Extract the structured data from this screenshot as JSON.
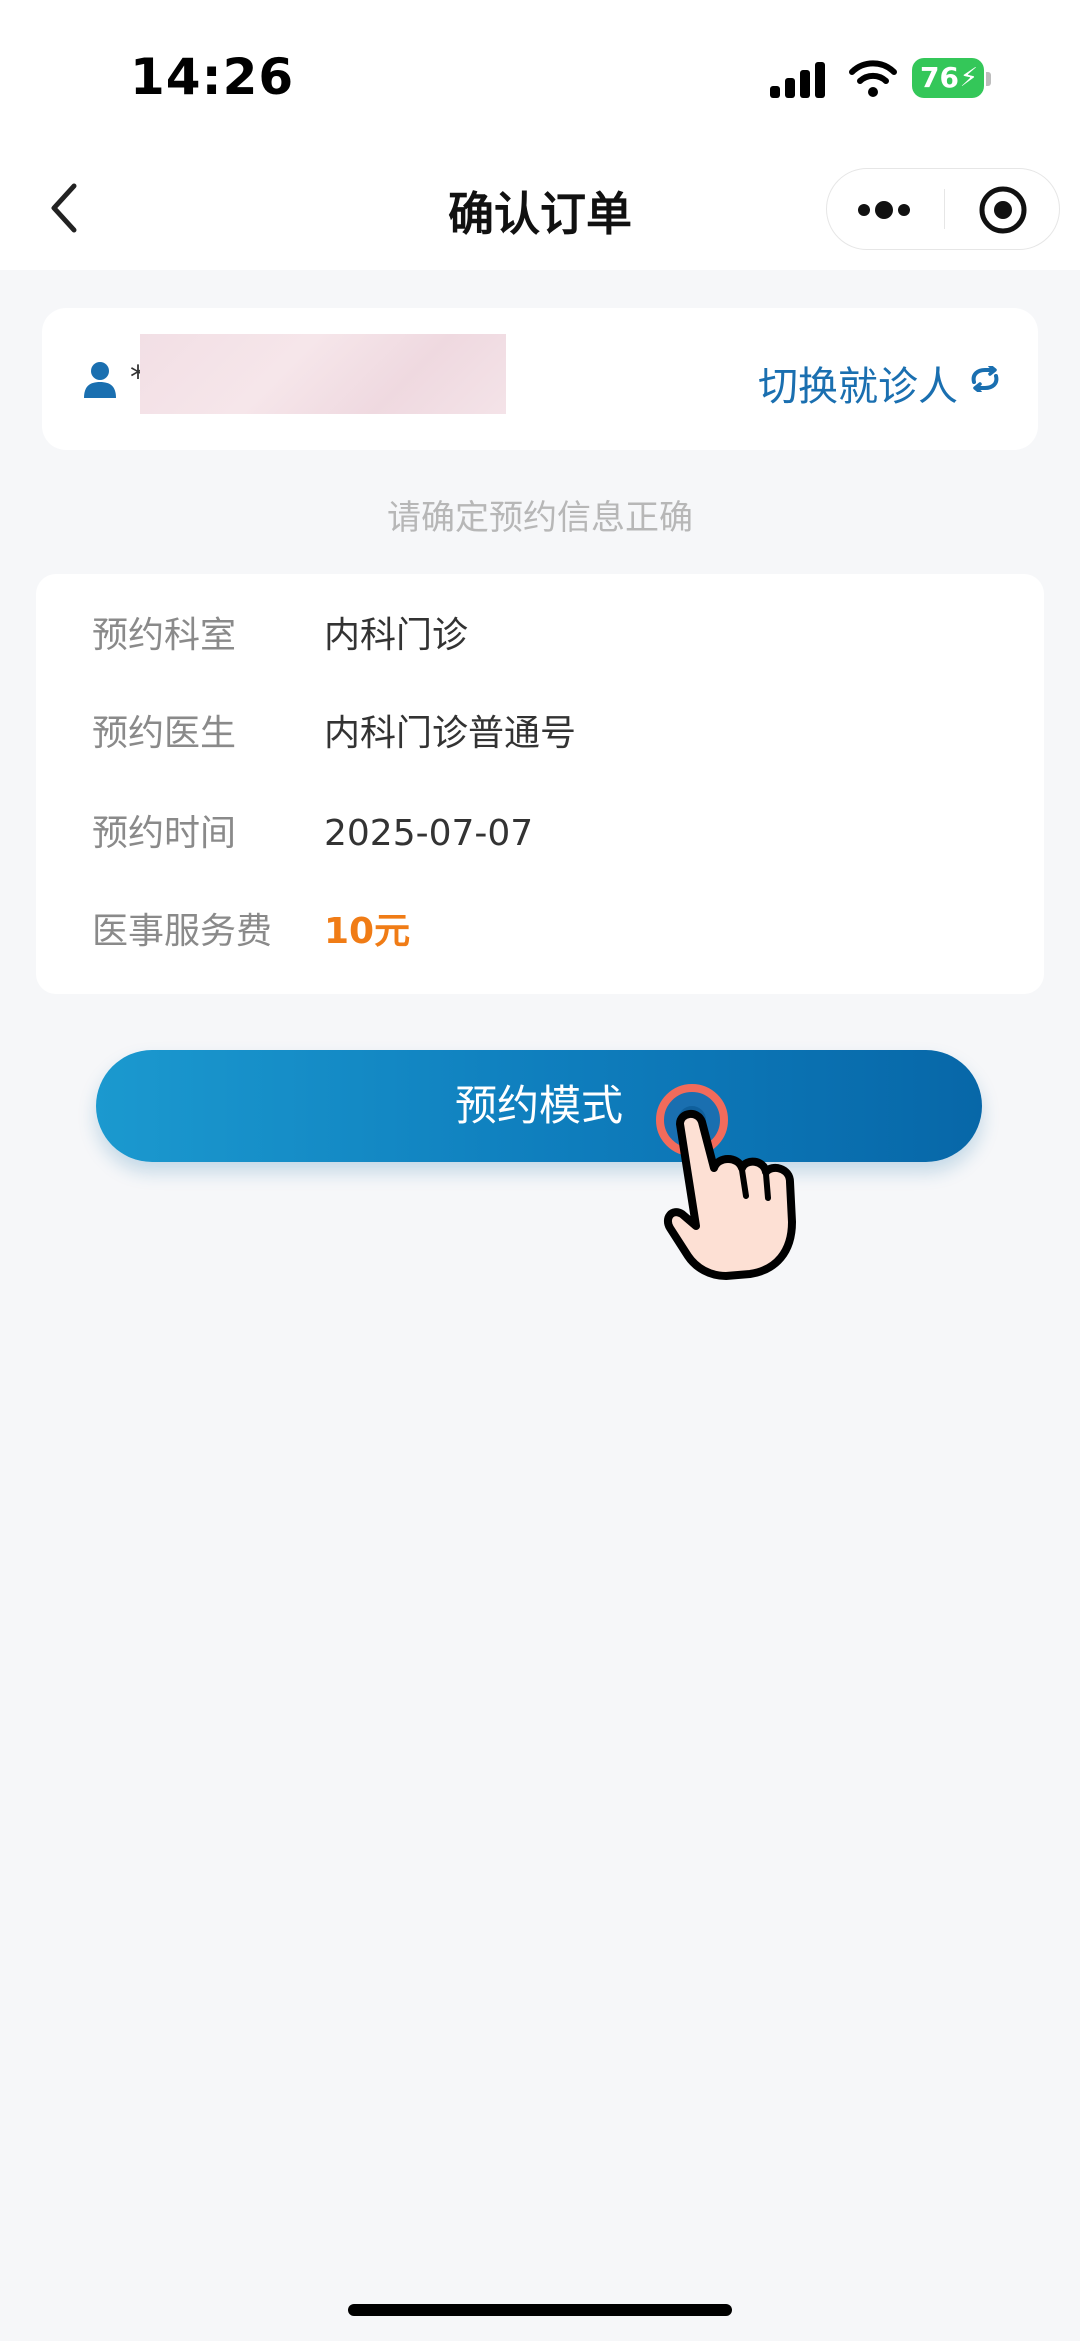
{
  "status_bar": {
    "time": "14:26",
    "battery_level": "76",
    "signal_bars": 4,
    "icons": [
      "cellular-signal-icon",
      "wifi-icon",
      "battery-charging-icon"
    ]
  },
  "nav": {
    "title": "确认订单",
    "back_icon": "chevron-left-icon",
    "more_icon": "more-dots-icon",
    "close_icon": "target-icon"
  },
  "patient": {
    "name_prefix": "*",
    "switch_label": "切换就诊人",
    "icons": [
      "person-icon",
      "switch-refresh-icon"
    ]
  },
  "hint": "请确定预约信息正确",
  "appointment": [
    {
      "label": "预约科室",
      "value": "内科门诊"
    },
    {
      "label": "预约医生",
      "value": "内科门诊普通号"
    },
    {
      "label": "预约时间",
      "value": "2025-07-07"
    },
    {
      "label": "医事服务费",
      "value": "10元"
    }
  ],
  "primary_button": {
    "label": "预约模式"
  },
  "colors": {
    "accent_blue": "#1a6fb0",
    "fee_orange": "#f07c16",
    "button_gradient_start": "#1b99cf",
    "button_gradient_end": "#0767a8",
    "battery_green": "#34c759",
    "page_background": "#f6f7f9"
  }
}
